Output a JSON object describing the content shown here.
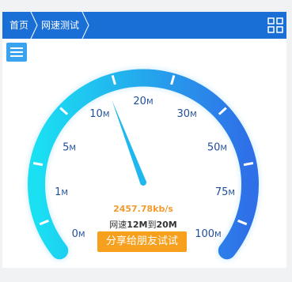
{
  "breadcrumb": {
    "home": "首页",
    "current": "网速测试"
  },
  "gauge": {
    "min_label": "0M",
    "needle_value_mbps": 13.5,
    "labels": [
      {
        "text": "0",
        "unit": "M"
      },
      {
        "text": "1",
        "unit": "M"
      },
      {
        "text": "5",
        "unit": "M"
      },
      {
        "text": "10",
        "unit": "M"
      },
      {
        "text": "20",
        "unit": "M"
      },
      {
        "text": "30",
        "unit": "M"
      },
      {
        "text": "50",
        "unit": "M"
      },
      {
        "text": "75",
        "unit": "M"
      },
      {
        "text": "100",
        "unit": "M"
      }
    ],
    "colors": {
      "arc_start": "#1ae0f2",
      "arc_end": "#2f6fe8",
      "needle": "#1fb8ee",
      "label": "#1f4e9a"
    }
  },
  "result": {
    "speed": "2457.78kb/s",
    "range_prefix": "网速",
    "range_low": "12M",
    "range_mid": "到",
    "range_high": "20M"
  },
  "share_button": {
    "label": "分享给朋友试试"
  },
  "icons": {
    "menu": "menu-icon",
    "grid": "grid-icon"
  }
}
